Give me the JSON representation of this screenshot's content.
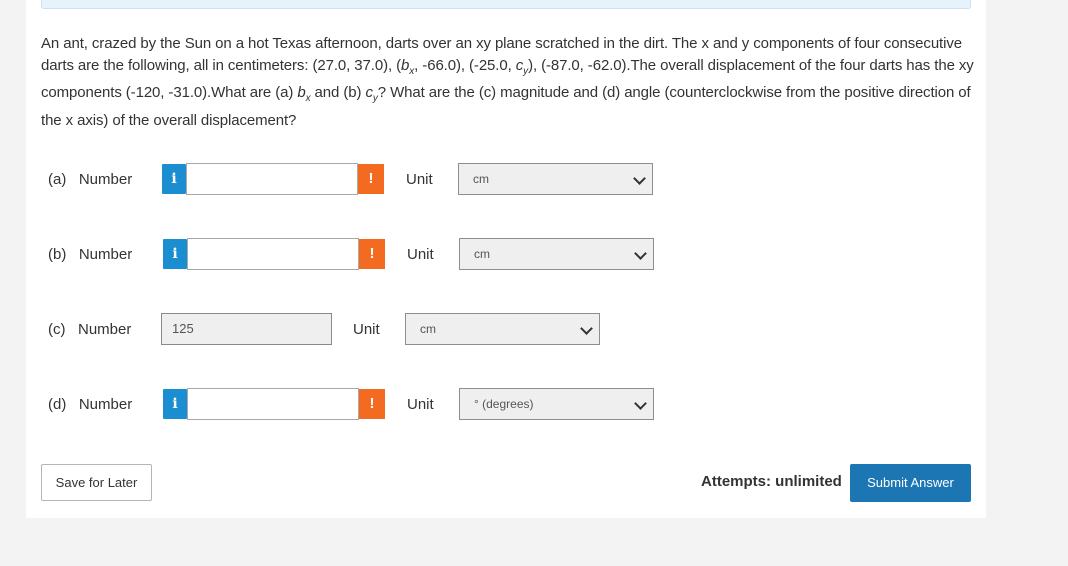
{
  "question": {
    "p1": "An ant, crazed by the Sun on a hot Texas afternoon, darts over an xy plane scratched in the dirt. The x and y components of four consecutive darts are the following, all in centimeters: (27.0, 37.0), (",
    "bx": "b",
    "bx_sub": "x",
    "p2": ", -66.0), (-25.0, ",
    "cy": "c",
    "cy_sub": "y",
    "p3": "), (-87.0, -62.0).The overall displacement of the four darts has the xy components (-120, -31.0).What are (a) ",
    "bx2": "b",
    "bx2_sub": "x",
    "p4": " and (b) ",
    "cy2": "c",
    "cy2_sub": "y",
    "p5": "? What are the (c) magnitude and (d) angle (counterclockwise from the positive direction of the x axis) of the overall displacement?"
  },
  "rows": [
    {
      "label": "(a)   Number",
      "info": "i",
      "value": "",
      "alert": "!",
      "unit_label": "Unit",
      "unit": "cm"
    },
    {
      "label": "(b)   Number",
      "info": "i",
      "value": "",
      "alert": "!",
      "unit_label": "Unit",
      "unit": "cm"
    },
    {
      "label": "(c)   Number",
      "value": "125",
      "unit_label": "Unit",
      "unit": "cm"
    },
    {
      "label": "(d)   Number",
      "info": "i",
      "value": "",
      "alert": "!",
      "unit_label": "Unit",
      "unit": "° (degrees)"
    }
  ],
  "footer": {
    "save_label": "Save for Later",
    "attempts": "Attempts: unlimited",
    "submit_label": "Submit Answer"
  },
  "colors": {
    "info": "#1a8ed1",
    "alert": "#f26b21",
    "submit": "#1b76b3"
  }
}
